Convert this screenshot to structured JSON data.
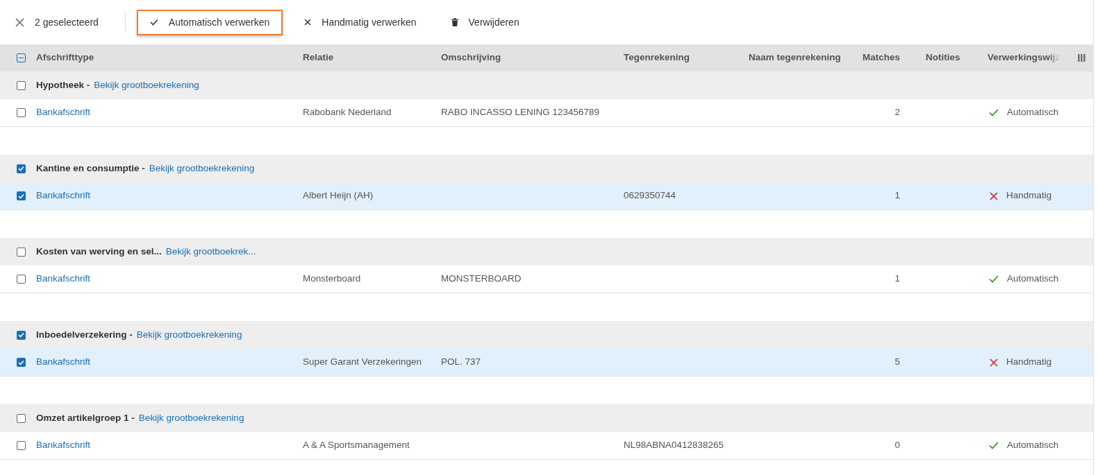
{
  "toolbar": {
    "selection_count": "2 geselecteerd",
    "actions": [
      {
        "kind": "check",
        "label": "Automatisch verwerken",
        "focused": true
      },
      {
        "kind": "cross",
        "label": "Handmatig verwerken",
        "focused": false
      },
      {
        "kind": "trash",
        "label": "Verwijderen",
        "focused": false
      }
    ]
  },
  "table": {
    "select_all": {
      "indeterminate": true
    },
    "columns": [
      "Afschrifttype",
      "Relatie",
      "Omschrijving",
      "Tegenrekening",
      "Naam tegenrekening",
      "Matches",
      "Notities",
      "Verwerkingswijz"
    ],
    "groups": [
      {
        "label": "Hypotheek -",
        "link": "Bekijk grootboekrekening",
        "checked": false,
        "rows": [
          {
            "type": "Bankafschrift",
            "relation": "Rabobank Nederland",
            "description": "RABO INCASSO LENING 123456789",
            "account": "",
            "account_name": "",
            "matches": "2",
            "notes": "",
            "kind": "auto",
            "mode": "Automatisch",
            "checked": false
          }
        ]
      },
      {
        "label": "Kantine en consumptie -",
        "link": "Bekijk grootboekrekening",
        "checked": true,
        "rows": [
          {
            "type": "Bankafschrift",
            "relation": "Albert Heijn (AH)",
            "description": "",
            "account": "0629350744",
            "account_name": "",
            "matches": "1",
            "notes": "",
            "kind": "manual",
            "mode": "Handmatig",
            "checked": true
          }
        ]
      },
      {
        "label": "Kosten van werving en sel...",
        "link": "Bekijk grootboekrek...",
        "checked": false,
        "rows": [
          {
            "type": "Bankafschrift",
            "relation": "Monsterboard",
            "description": "MONSTERBOARD",
            "account": "",
            "account_name": "",
            "matches": "1",
            "notes": "",
            "kind": "auto",
            "mode": "Automatisch",
            "checked": false
          }
        ]
      },
      {
        "label": "Inboedelverzekering -",
        "link": "Bekijk grootboekrekening",
        "checked": true,
        "rows": [
          {
            "type": "Bankafschrift",
            "relation": "Super Garant Verzekeringen",
            "description": "POL. 737",
            "account": "",
            "account_name": "",
            "matches": "5",
            "notes": "",
            "kind": "manual",
            "mode": "Handmatig",
            "checked": true
          }
        ]
      },
      {
        "label": "Omzet artikelgroep 1 -",
        "link": "Bekijk grootboekrekening",
        "checked": false,
        "rows": [
          {
            "type": "Bankafschrift",
            "relation": "A & A Sportsmanagement",
            "description": "",
            "account": "NL98ABNA0412838265",
            "account_name": "",
            "matches": "0",
            "notes": "",
            "kind": "auto",
            "mode": "Automatisch",
            "checked": false
          }
        ]
      }
    ]
  }
}
